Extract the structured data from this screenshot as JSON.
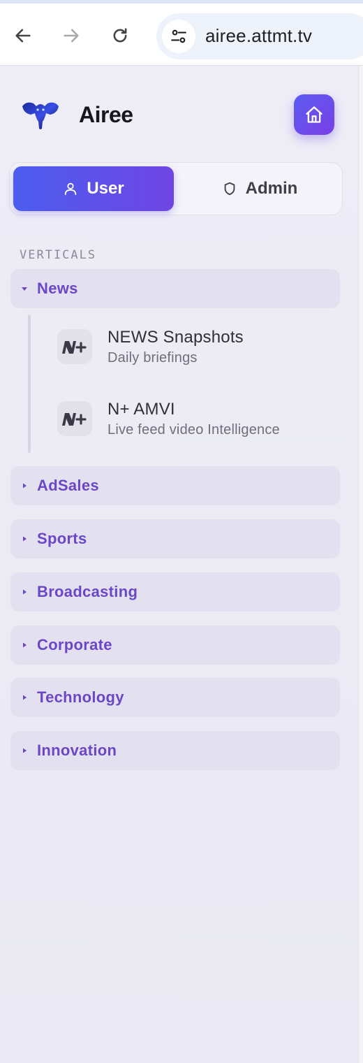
{
  "browser": {
    "url": "airee.attmt.tv",
    "back_icon": "arrow-left-icon",
    "forward_icon": "arrow-right-icon",
    "reload_icon": "reload-icon",
    "site_info_icon": "tune-icon"
  },
  "sidebar": {
    "brand": {
      "name": "Airee",
      "logo_icon": "elephant-logo-icon",
      "accent": "#3a4de8"
    },
    "home_icon": "home-icon",
    "roles": [
      {
        "label": "User",
        "icon": "user-icon",
        "active": true
      },
      {
        "label": "Admin",
        "icon": "shield-icon",
        "active": false
      }
    ],
    "section_label": "VERTICALS",
    "verticals": [
      {
        "label": "News",
        "expanded": true,
        "items": [
          {
            "title": "NEWS Snapshots",
            "description": "Daily briefings",
            "icon": "n-plus-logo-icon"
          },
          {
            "title": "N+ AMVI",
            "description": "Live feed video Intelligence",
            "icon": "n-plus-logo-icon"
          }
        ]
      },
      {
        "label": "AdSales",
        "expanded": false
      },
      {
        "label": "Sports",
        "expanded": false
      },
      {
        "label": "Broadcasting",
        "expanded": false
      },
      {
        "label": "Corporate",
        "expanded": false
      },
      {
        "label": "Technology",
        "expanded": false
      },
      {
        "label": "Innovation",
        "expanded": false
      }
    ]
  },
  "colors": {
    "primary_gradient_start": "#4b5ded",
    "primary_gradient_end": "#7a3fe6",
    "vertical_label": "#6b47c6"
  }
}
